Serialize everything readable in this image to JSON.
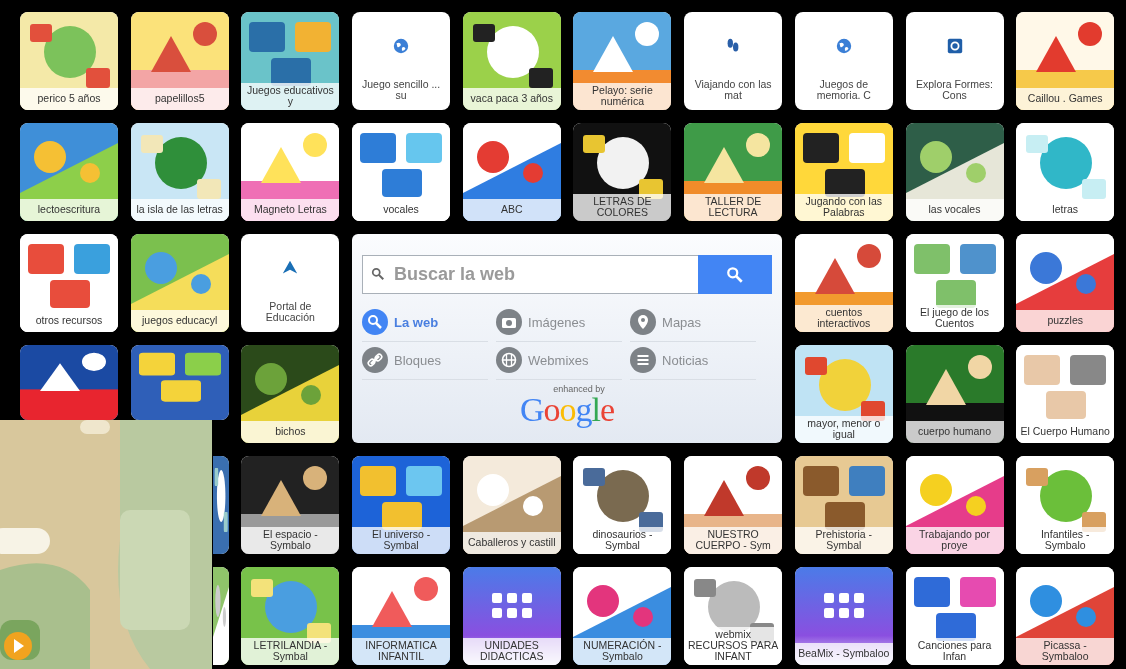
{
  "rows": [
    [
      {
        "kind": "picture",
        "label": "perico 5 años"
      },
      {
        "kind": "picture",
        "label": "papelillos5"
      },
      {
        "kind": "picture",
        "label": "Juegos educativos y"
      },
      {
        "kind": "icon",
        "label": "Juego sencillo ... su"
      },
      {
        "kind": "picture",
        "label": "vaca paca 3 años"
      },
      {
        "kind": "picture",
        "label": "Pelayo: serie numérica"
      },
      {
        "kind": "icon",
        "label": "Viajando con las mat"
      },
      {
        "kind": "icon",
        "label": "Juegos de memoria. C"
      },
      {
        "kind": "icon",
        "label": "Explora Formes: Cons"
      },
      {
        "kind": "picture",
        "label": "Caillou . Games"
      }
    ],
    [
      {
        "kind": "picture",
        "label": "lectoescritura"
      },
      {
        "kind": "picture",
        "label": "la isla  de las letras"
      },
      {
        "kind": "picture",
        "label": "Magneto Letras"
      },
      {
        "kind": "picture",
        "label": "vocales"
      },
      {
        "kind": "picture",
        "label": "ABC"
      },
      {
        "kind": "picture",
        "label": "LETRAS DE COLORES"
      },
      {
        "kind": "picture",
        "label": "TALLER DE LECTURA"
      },
      {
        "kind": "picture",
        "label": "Jugando con las Palabras"
      },
      {
        "kind": "picture",
        "label": "las vocales"
      },
      {
        "kind": "picture",
        "label": "letras"
      }
    ],
    [
      {
        "kind": "picture",
        "label": "otros recursos"
      },
      {
        "kind": "picture",
        "label": "juegos educacyl"
      },
      {
        "kind": "icon",
        "label": "Portal de Educación"
      },
      {
        "kind": "picture",
        "label": "cuentos interactivos"
      },
      {
        "kind": "picture",
        "label": "El juego de los Cuentos"
      },
      {
        "kind": "picture",
        "label": "puzzles"
      }
    ],
    [
      {
        "kind": "picture"
      },
      {
        "kind": "picture"
      },
      {
        "kind": "picture",
        "label": "bichos"
      },
      {
        "kind": "picture",
        "label": "mayor, menor o igual"
      },
      {
        "kind": "picture",
        "label": "cuerpo humano"
      },
      {
        "kind": "picture",
        "label": "El Cuerpo Humano"
      }
    ],
    [
      {
        "kind": "picture"
      },
      {
        "kind": "picture",
        "label": "El espacio - Symbalo"
      },
      {
        "kind": "picture",
        "label": "El universo - Symbal"
      },
      {
        "kind": "picture",
        "label": "Caballeros y castill"
      },
      {
        "kind": "picture",
        "label": "dinosaurios - Symbal"
      },
      {
        "kind": "picture",
        "label": "NUESTRO CUERPO - Sym"
      },
      {
        "kind": "picture",
        "label": "Prehistoria - Symbal"
      },
      {
        "kind": "picture",
        "label": "Trabajando por proye"
      },
      {
        "kind": "picture",
        "label": "Infantiles - Symbalo"
      }
    ],
    [
      {
        "kind": "picture"
      },
      {
        "kind": "picture",
        "label": "LETRILANDIA - Symbal"
      },
      {
        "kind": "picture",
        "label": "INFORMATICA INFANTIL"
      },
      {
        "kind": "webmix",
        "label": "UNIDADES DIDACTICAS"
      },
      {
        "kind": "picture",
        "label": "NUMERACIÓN - Symbalo"
      },
      {
        "kind": "picture",
        "label": "webmix RECURSOS PARA INFANT"
      },
      {
        "kind": "webmix",
        "label": "BeaMix - Symbaloo"
      },
      {
        "kind": "picture",
        "label": "Canciones para Infan"
      },
      {
        "kind": "picture",
        "label": "Picassa - Symbaloo"
      }
    ]
  ],
  "search": {
    "placeholder": "Buscar la web",
    "options": [
      {
        "label": "La web",
        "selected": true
      },
      {
        "label": "Imágenes",
        "selected": false
      },
      {
        "label": "Mapas",
        "selected": false
      },
      {
        "label": "Bloques",
        "selected": false
      },
      {
        "label": "Webmixes",
        "selected": false
      },
      {
        "label": "Noticias",
        "selected": false
      }
    ],
    "enhanced": "enhanced by",
    "brand": "Google"
  },
  "overlay": {
    "kind": "picture"
  }
}
